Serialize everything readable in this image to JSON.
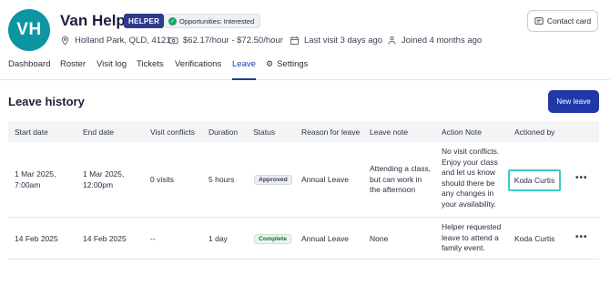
{
  "profile": {
    "initials": "VH",
    "name": "Van Helper",
    "role_badge": "HELPER",
    "opportunity_badge": "Opportunities: Interested",
    "location": "Holland Park, QLD, 4121",
    "rate": "$62.17/hour - $72.50/hour",
    "last_visit": "Last visit 3 days ago",
    "joined": "Joined 4 months ago",
    "contact_button": "Contact card"
  },
  "tabs": [
    "Dashboard",
    "Roster",
    "Visit log",
    "Tickets",
    "Verifications",
    "Leave",
    "Settings"
  ],
  "active_tab": "Leave",
  "section": {
    "title": "Leave history",
    "new_button": "New leave"
  },
  "table": {
    "headers": [
      "Start date",
      "End date",
      "Visit conflicts",
      "Duration",
      "Status",
      "Reason for leave",
      "Leave note",
      "Action Note",
      "Actioned by"
    ],
    "rows": [
      {
        "start": [
          "1 Mar 2025,",
          "7:00am"
        ],
        "end": [
          "1 Mar 2025,",
          "12:00pm"
        ],
        "conflicts": "0 visits",
        "duration": "5 hours",
        "status": "Approved",
        "reason": "Annual Leave",
        "note": [
          "Attending a class,",
          "but can work in",
          "the afternoon"
        ],
        "action_note": [
          "No visit conflicts.",
          "Enjoy your class",
          "and let us know",
          "should there be",
          "any changes in",
          "your availability."
        ],
        "actioned_by": "Koda Curtis"
      },
      {
        "start": [
          "14 Feb 2025"
        ],
        "end": [
          "14 Feb 2025"
        ],
        "conflicts": "--",
        "duration": "1 day",
        "status": "Complete",
        "reason": "Annual Leave",
        "note": [
          "None"
        ],
        "action_note": [
          "Helper requested",
          "leave to attend a",
          "family event."
        ],
        "actioned_by": "Koda Curtis"
      }
    ]
  },
  "colors": {
    "avatar": "#0d96a2",
    "primary": "#1f3aa8",
    "role_badge": "#2e3a8c",
    "highlight": "#3ec8c4"
  }
}
